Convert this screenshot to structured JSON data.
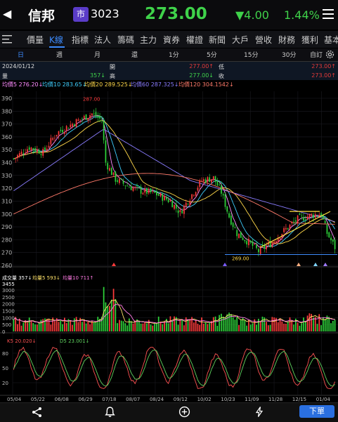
{
  "header": {
    "back_icon": "chevron-left-icon",
    "stock_name": "信邦",
    "market_badge": "市",
    "stock_code": "3023",
    "price": "273.00",
    "change": "▼4.00",
    "change_pct": "1.44%",
    "menu_icon": "hamburger-icon"
  },
  "tabs": [
    {
      "label": "價量"
    },
    {
      "label": "K線"
    },
    {
      "label": "指標"
    },
    {
      "label": "法人"
    },
    {
      "label": "籌碼"
    },
    {
      "label": "主力"
    },
    {
      "label": "資券"
    },
    {
      "label": "權證"
    },
    {
      "label": "新聞"
    },
    {
      "label": "大戶"
    },
    {
      "label": "營收"
    },
    {
      "label": "財務"
    },
    {
      "label": "獲利"
    },
    {
      "label": "基本"
    }
  ],
  "periods": [
    {
      "label": "日"
    },
    {
      "label": "週"
    },
    {
      "label": "月"
    },
    {
      "label": "還"
    },
    {
      "label": "1分"
    },
    {
      "label": "5分"
    },
    {
      "label": "15分"
    },
    {
      "label": "30分"
    },
    {
      "label": "自訂"
    }
  ],
  "info": {
    "date": "2024/01/12",
    "open_label": "開",
    "open_value": "277.00↑",
    "low_label": "低",
    "low_value": "273.00↑",
    "volume_label": "量",
    "volume_value": "357↓",
    "high_label": "高",
    "high_value": "277.00↓",
    "close_label": "收",
    "close_value": "273.00↑"
  },
  "ma_legend": [
    {
      "text": "均價5 276.20↓",
      "color": "#ff8cff"
    },
    {
      "text": "均價10 283.65↓",
      "color": "#3fd0ff"
    },
    {
      "text": "均價20 289.525↓",
      "color": "#ffd84a"
    },
    {
      "text": "均價60 287.325↓",
      "color": "#8a7cff"
    },
    {
      "text": "均價120 304.1542↓",
      "color": "#ff7a6a"
    }
  ],
  "price_axis": [
    "390",
    "380",
    "370",
    "360",
    "350",
    "340",
    "330",
    "320",
    "310",
    "300",
    "290",
    "280",
    "270",
    "260"
  ],
  "annotations": {
    "high_label": "287.00",
    "low_label": "269.00"
  },
  "volume_legend": [
    {
      "text": "成交量 357↓",
      "color": "#ffffff"
    },
    {
      "text": "均量5 593↓",
      "color": "#ffe26a"
    },
    {
      "text": "均量10 711↑",
      "color": "#ff7be5"
    }
  ],
  "volume_axis": [
    "3455",
    "3000",
    "2500",
    "2000",
    "1500",
    "1000",
    "500",
    "0"
  ],
  "kd_legend": [
    {
      "text": "K5 20.020↓",
      "color": "#ff5252"
    },
    {
      "text": "D5 23.001↓",
      "color": "#5fd35f"
    }
  ],
  "kd_axis": [
    "80",
    "50",
    "20"
  ],
  "x_labels": [
    "05/04",
    "05/22",
    "06/08",
    "06/29",
    "07/18",
    "08/07",
    "08/24",
    "09/12",
    "10/02",
    "10/23",
    "11/09",
    "11/28",
    "12/15",
    "01/04"
  ],
  "colors": {
    "up": "#ff3b3b",
    "down": "#2ed43a",
    "accent": "#3d8bfd"
  },
  "bottom_bar": {
    "share_icon": "share-icon",
    "bell_icon": "bell-icon",
    "add_icon": "plus-circle-icon",
    "flash_icon": "lightning-icon",
    "order_label": "下單"
  },
  "chart_data": {
    "type": "candlestick",
    "y_range": [
      260,
      390
    ],
    "x_ticks": [
      "05/04",
      "05/22",
      "06/08",
      "06/29",
      "07/18",
      "08/07",
      "08/24",
      "09/12",
      "10/02",
      "10/23",
      "11/09",
      "11/28",
      "12/15",
      "01/04"
    ],
    "marked_high": 287.0,
    "marked_low": 269.0,
    "last_close": 273.0
  }
}
